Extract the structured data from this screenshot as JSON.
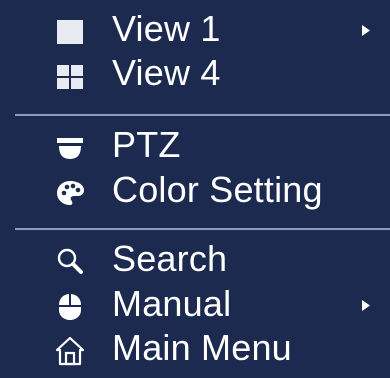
{
  "menu": {
    "items": [
      {
        "label": "View 1",
        "icon": "single-view-icon",
        "has_submenu": true
      },
      {
        "label": "View 4",
        "icon": "quad-view-icon",
        "has_submenu": false
      },
      {
        "label": "PTZ",
        "icon": "ptz-camera-icon",
        "has_submenu": false
      },
      {
        "label": "Color Setting",
        "icon": "color-palette-icon",
        "has_submenu": false
      },
      {
        "label": "Search",
        "icon": "search-icon",
        "has_submenu": false
      },
      {
        "label": "Manual",
        "icon": "mouse-icon",
        "has_submenu": true
      },
      {
        "label": "Main Menu",
        "icon": "home-icon",
        "has_submenu": false
      }
    ]
  },
  "colors": {
    "background": "#1c2a50",
    "text": "#ffffff",
    "separator": "#8d9bb8",
    "icon": "#ffffff"
  }
}
